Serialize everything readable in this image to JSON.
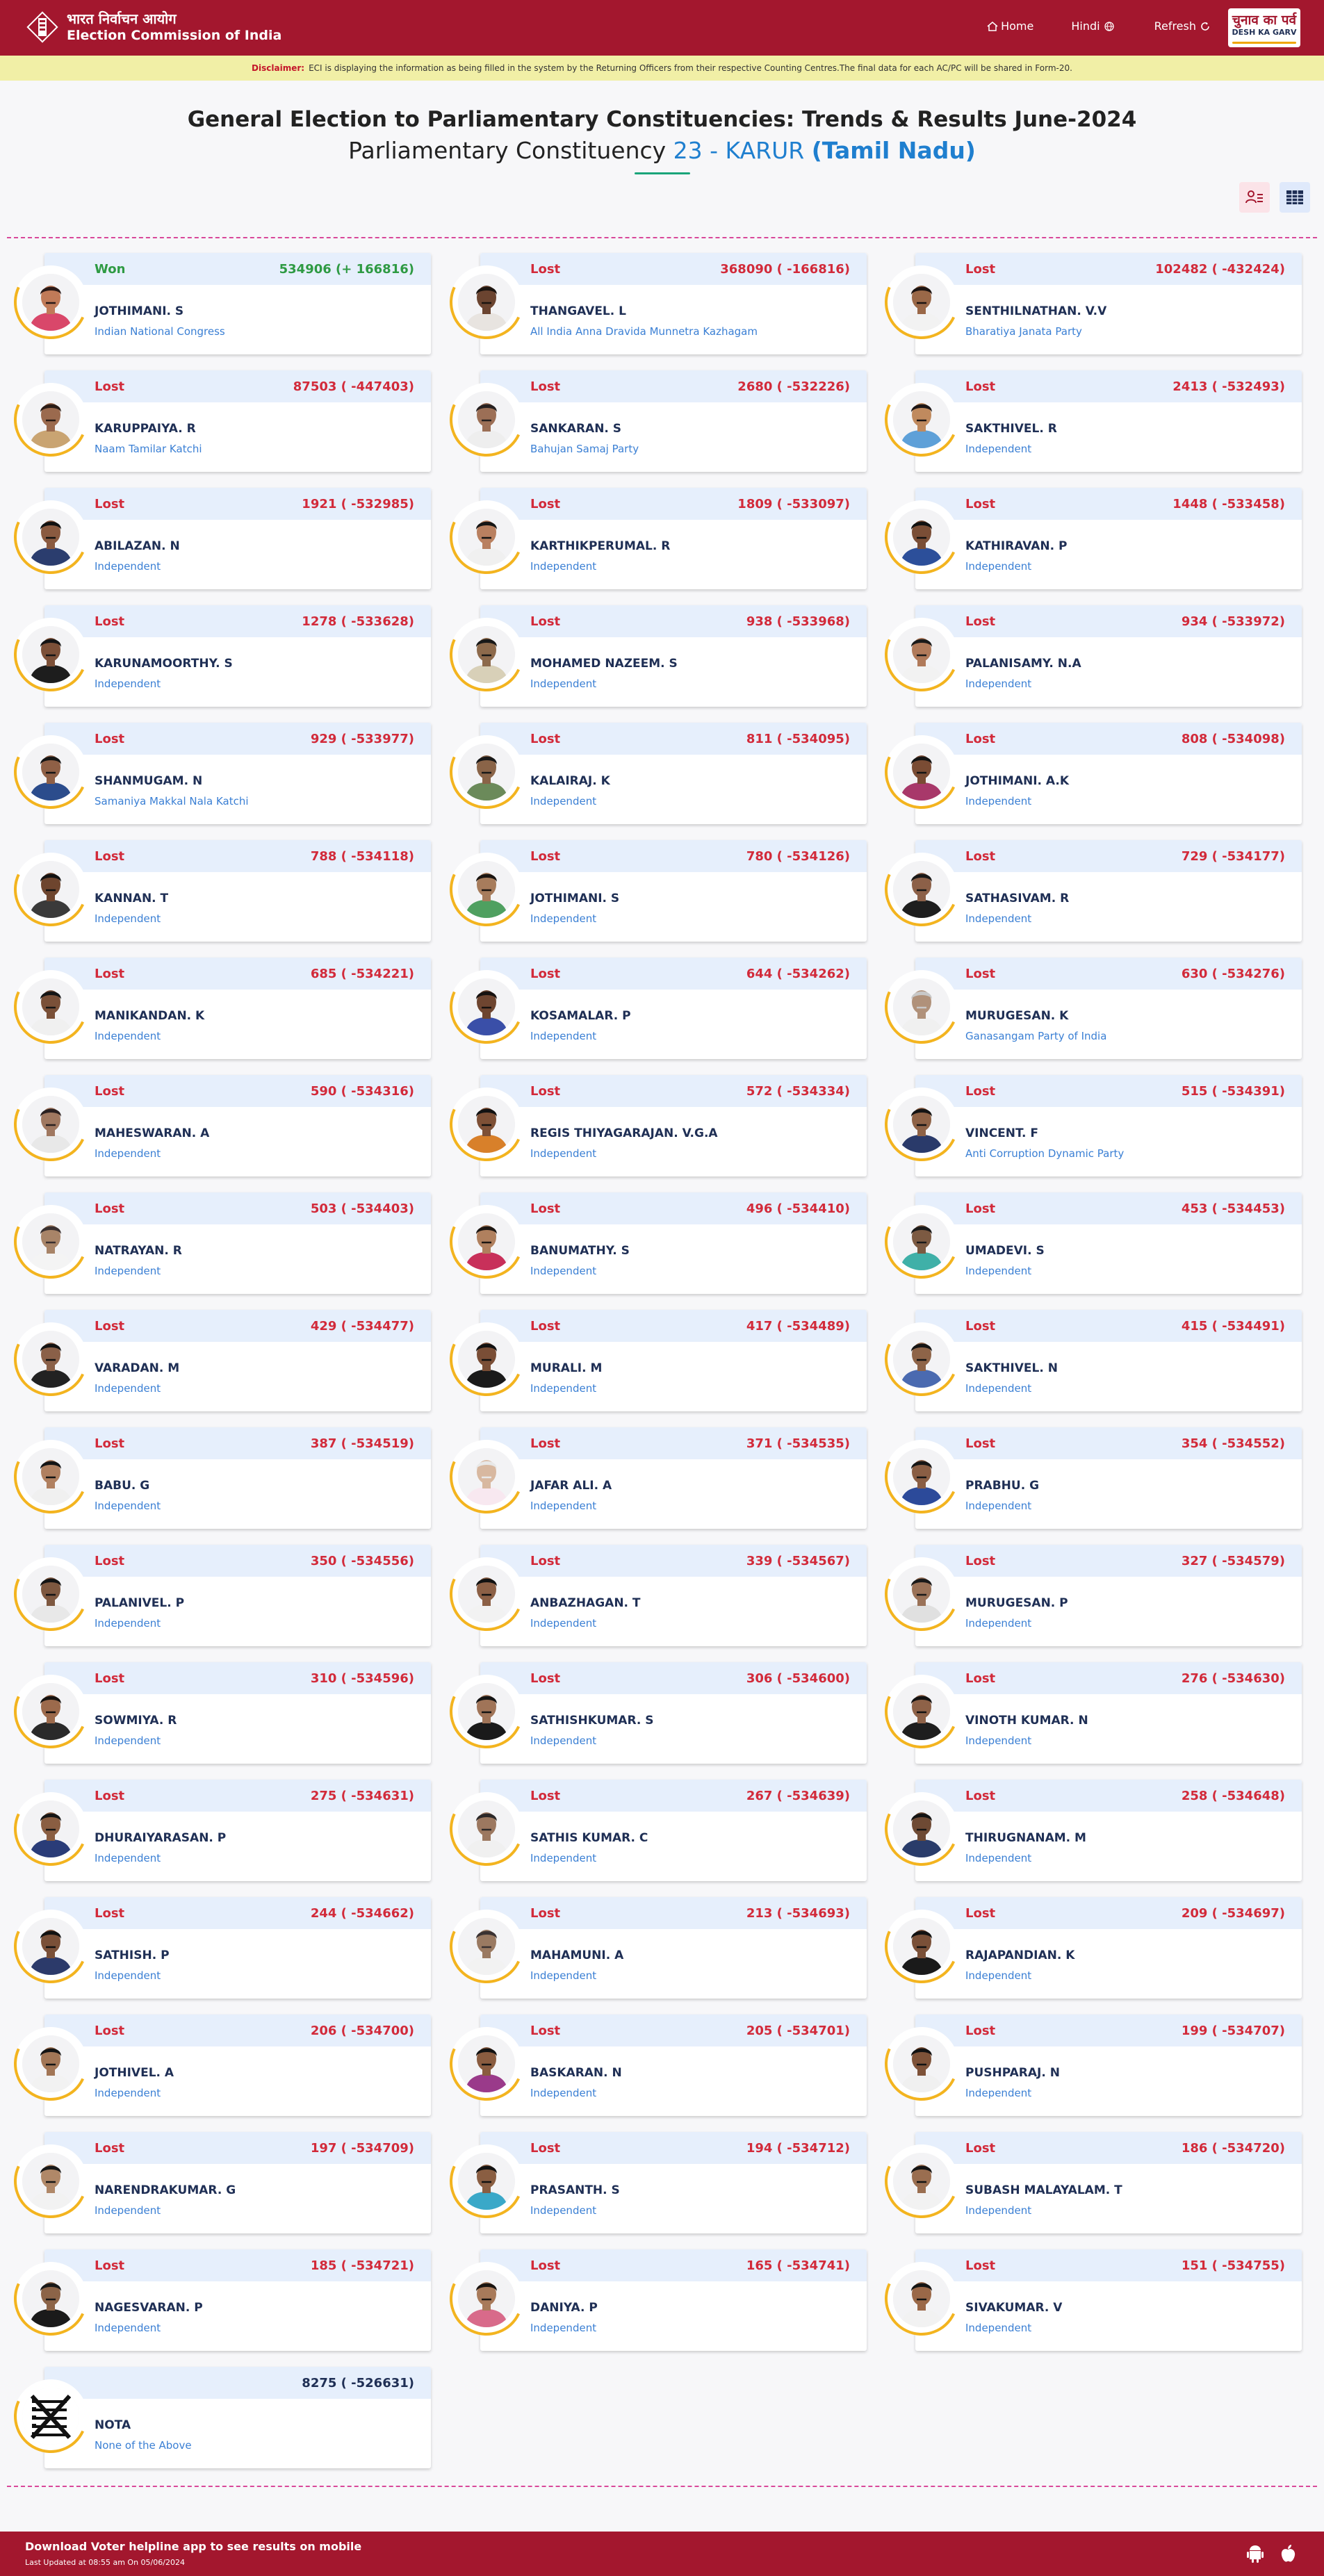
{
  "header": {
    "logo_hindi": "भारत निर्वाचन आयोग",
    "logo_english": "Election Commission of India",
    "nav": {
      "home": "Home",
      "hindi": "Hindi",
      "refresh": "Refresh"
    },
    "dkg_line1": "चुनाव का पर्व",
    "dkg_line2": "DESH KA GARV",
    "brand_color": "#a3172e"
  },
  "disclaimer": {
    "label": "Disclaimer:",
    "text": "ECI is displaying the information as being filled in the system by the Returning Officers from their respective Counting Centres.The final data for each AC/PC will be shared in Form-20."
  },
  "title": {
    "line1": "General Election to Parliamentary Constituencies: Trends & Results June-2024",
    "line2_prefix": "Parliamentary Constituency",
    "pc_number": "23 - KARUR",
    "state": "(Tamil Nadu)"
  },
  "view_icons": [
    "candidate-list-icon",
    "table-view-icon"
  ],
  "candidates": [
    {
      "status": "Won",
      "votes": "534906 (+ 166816)",
      "name": "JOTHIMANI. S",
      "party": "Indian National Congress",
      "photo": [
        "#c07a58",
        "#2a1a18",
        "#d9476a"
      ]
    },
    {
      "status": "Lost",
      "votes": "368090 ( -166816)",
      "name": "THANGAVEL. L",
      "party": "All India Anna Dravida Munnetra Kazhagam",
      "photo": [
        "#6b4430",
        "#1b1410",
        "#e8e4e0"
      ]
    },
    {
      "status": "Lost",
      "votes": "102482 ( -432424)",
      "name": "SENTHILNATHAN. V.V",
      "party": "Bharatiya Janata Party",
      "photo": [
        "#9a6848",
        "#1c1412",
        "#f2f2f2"
      ]
    },
    {
      "status": "Lost",
      "votes": "87503 ( -447403)",
      "name": "KARUPPAIYA. R",
      "party": "Naam Tamilar Katchi",
      "photo": [
        "#9b6a4e",
        "#2a1c16",
        "#c9a472"
      ]
    },
    {
      "status": "Lost",
      "votes": "2680 ( -532226)",
      "name": "SANKARAN. S",
      "party": "Bahujan Samaj Party",
      "photo": [
        "#9c6f56",
        "#262020",
        "#eeeeee"
      ]
    },
    {
      "status": "Lost",
      "votes": "2413 ( -532493)",
      "name": "SAKTHIVEL. R",
      "party": "Independent",
      "photo": [
        "#c08a5e",
        "#1c1616",
        "#5ea0d8"
      ]
    },
    {
      "status": "Lost",
      "votes": "1921 ( -532985)",
      "name": "ABILAZAN. N",
      "party": "Independent",
      "photo": [
        "#8a5a40",
        "#111111",
        "#2b3d6e"
      ]
    },
    {
      "status": "Lost",
      "votes": "1809 ( -533097)",
      "name": "KARTHIKPERUMAL. R",
      "party": "Independent",
      "photo": [
        "#b98060",
        "#151515",
        "#f0f0f0"
      ]
    },
    {
      "status": "Lost",
      "votes": "1448 ( -533458)",
      "name": "KATHIRAVAN. P",
      "party": "Independent",
      "photo": [
        "#7a4e36",
        "#111111",
        "#2c4f9a"
      ]
    },
    {
      "status": "Lost",
      "votes": "1278 ( -533628)",
      "name": "KARUNAMOORTHY. S",
      "party": "Independent",
      "photo": [
        "#7c5038",
        "#141414",
        "#1d1d1d"
      ]
    },
    {
      "status": "Lost",
      "votes": "938 ( -533968)",
      "name": "MOHAMED NAZEEM. S",
      "party": "Independent",
      "photo": [
        "#8d6a4c",
        "#181818",
        "#d8d0b8"
      ]
    },
    {
      "status": "Lost",
      "votes": "934 ( -533972)",
      "name": "PALANISAMY. N.A",
      "party": "Independent",
      "photo": [
        "#b07a5a",
        "#1a1a1a",
        "#f2f2f2"
      ]
    },
    {
      "status": "Lost",
      "votes": "929 ( -533977)",
      "name": "SHANMUGAM. N",
      "party": "Samaniya Makkal Nala Katchi",
      "photo": [
        "#8f6046",
        "#151515",
        "#2b4c8c"
      ]
    },
    {
      "status": "Lost",
      "votes": "811 ( -534095)",
      "name": "KALAIRAJ. K",
      "party": "Independent",
      "photo": [
        "#8a6448",
        "#181818",
        "#6b8a5a"
      ]
    },
    {
      "status": "Lost",
      "votes": "808 ( -534098)",
      "name": "JOTHIMANI. A.K",
      "party": "Independent",
      "photo": [
        "#7a4c34",
        "#141414",
        "#a8386a"
      ]
    },
    {
      "status": "Lost",
      "votes": "788 ( -534118)",
      "name": "KANNAN. T",
      "party": "Independent",
      "photo": [
        "#6e452e",
        "#121212",
        "#3a3a3a"
      ]
    },
    {
      "status": "Lost",
      "votes": "780 ( -534126)",
      "name": "JOTHIMANI. S",
      "party": "Independent",
      "photo": [
        "#a77c5c",
        "#1a1410",
        "#4fa060"
      ]
    },
    {
      "status": "Lost",
      "votes": "729 ( -534177)",
      "name": "SATHASIVAM. R",
      "party": "Independent",
      "photo": [
        "#8c6048",
        "#181818",
        "#1e1e1e"
      ]
    },
    {
      "status": "Lost",
      "votes": "685 ( -534221)",
      "name": "MANIKANDAN. K",
      "party": "Independent",
      "photo": [
        "#7a5038",
        "#151515",
        "#f0f0f0"
      ]
    },
    {
      "status": "Lost",
      "votes": "644 ( -534262)",
      "name": "KOSAMALAR. P",
      "party": "Independent",
      "photo": [
        "#6e4530",
        "#161210",
        "#3a4fa8"
      ]
    },
    {
      "status": "Lost",
      "votes": "630 ( -534276)",
      "name": "MURUGESAN. K",
      "party": "Ganasangam Party of India",
      "photo": [
        "#b0917a",
        "#c8c8c8",
        "#f0f0f0"
      ]
    },
    {
      "status": "Lost",
      "votes": "590 ( -534316)",
      "name": "MAHESWARAN. A",
      "party": "Independent",
      "photo": [
        "#a07860",
        "#2a2020",
        "#e8e8e8"
      ]
    },
    {
      "status": "Lost",
      "votes": "572 ( -534334)",
      "name": "REGIS THIYAGARAJAN. V.G.A",
      "party": "Independent",
      "photo": [
        "#7e5036",
        "#121212",
        "#d8802a"
      ]
    },
    {
      "status": "Lost",
      "votes": "515 ( -534391)",
      "name": "VINCENT. F",
      "party": "Anti Corruption Dynamic Party",
      "photo": [
        "#8e6246",
        "#141414",
        "#2a3a6a"
      ]
    },
    {
      "status": "Lost",
      "votes": "503 ( -534403)",
      "name": "NATRAYAN. R",
      "party": "Independent",
      "photo": [
        "#a88468",
        "#3a3030",
        "#f4f4f4"
      ]
    },
    {
      "status": "Lost",
      "votes": "496 ( -534410)",
      "name": "BANUMATHY. S",
      "party": "Independent",
      "photo": [
        "#b0805e",
        "#1c1612",
        "#c8305a"
      ]
    },
    {
      "status": "Lost",
      "votes": "453 ( -534453)",
      "name": "UMADEVI. S",
      "party": "Independent",
      "photo": [
        "#7c5a42",
        "#1a1a1a",
        "#3fb0a8"
      ]
    },
    {
      "status": "Lost",
      "votes": "429 ( -534477)",
      "name": "VARADAN. M",
      "party": "Independent",
      "photo": [
        "#8a6048",
        "#121212",
        "#222222"
      ]
    },
    {
      "status": "Lost",
      "votes": "417 ( -534489)",
      "name": "MURALI. M",
      "party": "Independent",
      "photo": [
        "#7a4e36",
        "#111111",
        "#1a1a1a"
      ]
    },
    {
      "status": "Lost",
      "votes": "415 ( -534491)",
      "name": "SAKTHIVEL. N",
      "party": "Independent",
      "photo": [
        "#8e6448",
        "#151515",
        "#4a6ab0"
      ]
    },
    {
      "status": "Lost",
      "votes": "387 ( -534519)",
      "name": "BABU. G",
      "party": "Independent",
      "photo": [
        "#b08060",
        "#141414",
        "#f0f0f0"
      ]
    },
    {
      "status": "Lost",
      "votes": "371 ( -534535)",
      "name": "JAFAR ALI. A",
      "party": "Independent",
      "photo": [
        "#d8b8a0",
        "#e8e8e8",
        "#f8e8f0"
      ]
    },
    {
      "status": "Lost",
      "votes": "354 ( -534552)",
      "name": "PRABHU. G",
      "party": "Independent",
      "photo": [
        "#8a5e44",
        "#151515",
        "#2c4a9a"
      ]
    },
    {
      "status": "Lost",
      "votes": "350 ( -534556)",
      "name": "PALANIVEL. P",
      "party": "Independent",
      "photo": [
        "#7e5840",
        "#141414",
        "#e8e8e8"
      ]
    },
    {
      "status": "Lost",
      "votes": "339 ( -534567)",
      "name": "ANBAZHAGAN. T",
      "party": "Independent",
      "photo": [
        "#8c6046",
        "#121212",
        "#f2f2f2"
      ]
    },
    {
      "status": "Lost",
      "votes": "327 ( -534579)",
      "name": "MURUGESAN. P",
      "party": "Independent",
      "photo": [
        "#9a7258",
        "#1a1a1a",
        "#e0e0e0"
      ]
    },
    {
      "status": "Lost",
      "votes": "310 ( -534596)",
      "name": "SOWMIYA. R",
      "party": "Independent",
      "photo": [
        "#9c6a4c",
        "#151210",
        "#2a2a2a"
      ]
    },
    {
      "status": "Lost",
      "votes": "306 ( -534600)",
      "name": "SATHISHKUMAR. S",
      "party": "Independent",
      "photo": [
        "#a07458",
        "#141414",
        "#1a1a1a"
      ]
    },
    {
      "status": "Lost",
      "votes": "276 ( -534630)",
      "name": "VINOTH KUMAR. N",
      "party": "Independent",
      "photo": [
        "#8e6248",
        "#121212",
        "#1e1e1e"
      ]
    },
    {
      "status": "Lost",
      "votes": "275 ( -534631)",
      "name": "DHURAIYARASAN. P",
      "party": "Independent",
      "photo": [
        "#8a5e42",
        "#151515",
        "#2a3c78"
      ]
    },
    {
      "status": "Lost",
      "votes": "267 ( -534639)",
      "name": "SATHIS KUMAR. C",
      "party": "Independent",
      "photo": [
        "#9c7860",
        "#2c2828",
        "#f0f0f0"
      ]
    },
    {
      "status": "Lost",
      "votes": "258 ( -534648)",
      "name": "THIRUGNANAM. M",
      "party": "Independent",
      "photo": [
        "#6e4a34",
        "#141414",
        "#2a3c6a"
      ]
    },
    {
      "status": "Lost",
      "votes": "244 ( -534662)",
      "name": "SATHISH. P",
      "party": "Independent",
      "photo": [
        "#7a5038",
        "#121212",
        "#2c3a6a"
      ]
    },
    {
      "status": "Lost",
      "votes": "213 ( -534693)",
      "name": "MAHAMUNI. A",
      "party": "Independent",
      "photo": [
        "#9a7a62",
        "#3a3232",
        "#f2f2f2"
      ]
    },
    {
      "status": "Lost",
      "votes": "209 ( -534697)",
      "name": "RAJAPANDIAN. K",
      "party": "Independent",
      "photo": [
        "#7a5038",
        "#121212",
        "#1a1a1a"
      ]
    },
    {
      "status": "Lost",
      "votes": "206 ( -534700)",
      "name": "JOTHIVEL. A",
      "party": "Independent",
      "photo": [
        "#a27656",
        "#141414",
        "#f2f2f2"
      ]
    },
    {
      "status": "Lost",
      "votes": "205 ( -534701)",
      "name": "BASKARAN. N",
      "party": "Independent",
      "photo": [
        "#8a5c40",
        "#121212",
        "#9a3a8a"
      ]
    },
    {
      "status": "Lost",
      "votes": "199 ( -534707)",
      "name": "PUSHPARAJ. N",
      "party": "Independent",
      "photo": [
        "#7e5238",
        "#121212",
        "#f0f0f0"
      ]
    },
    {
      "status": "Lost",
      "votes": "197 ( -534709)",
      "name": "NARENDRAKUMAR. G",
      "party": "Independent",
      "photo": [
        "#b08868",
        "#181818",
        "#f2f2f2"
      ]
    },
    {
      "status": "Lost",
      "votes": "194 ( -534712)",
      "name": "PRASANTH. S",
      "party": "Independent",
      "photo": [
        "#8a5e42",
        "#121212",
        "#3aa8c8"
      ]
    },
    {
      "status": "Lost",
      "votes": "186 ( -534720)",
      "name": "SUBASH MALAYALAM. T",
      "party": "Independent",
      "photo": [
        "#9a6e50",
        "#141414",
        "#f2f2f2"
      ]
    },
    {
      "status": "Lost",
      "votes": "185 ( -534721)",
      "name": "NAGESVARAN. P",
      "party": "Independent",
      "photo": [
        "#8c6448",
        "#181818",
        "#1a1a1a"
      ]
    },
    {
      "status": "Lost",
      "votes": "165 ( -534741)",
      "name": "DANIYA. P",
      "party": "Independent",
      "photo": [
        "#a87a5a",
        "#1a1410",
        "#d86a8a"
      ]
    },
    {
      "status": "Lost",
      "votes": "151 ( -534755)",
      "name": "SIVAKUMAR. V",
      "party": "Independent",
      "photo": [
        "#9a6848",
        "#141414",
        "#f2f2f2"
      ]
    },
    {
      "status": "",
      "votes": "8275 ( -526631)",
      "name": "NOTA",
      "party": "None of the Above",
      "photo": [
        "nota"
      ]
    }
  ],
  "footer": {
    "line1": "Download Voter helpline app to see results on mobile",
    "line2": "Last Updated at 08:55 am On 05/06/2024"
  }
}
